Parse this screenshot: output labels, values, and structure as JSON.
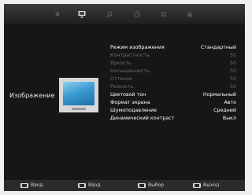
{
  "tabs": [
    {
      "icon": "tv-screen-icon",
      "active": false
    },
    {
      "icon": "display-icon",
      "active": true
    },
    {
      "icon": "music-note-icon",
      "active": false
    },
    {
      "icon": "clock-icon",
      "active": false
    },
    {
      "icon": "grid-icon",
      "active": false
    },
    {
      "icon": "lock-icon",
      "active": false
    }
  ],
  "category": "Изображение",
  "menu": [
    {
      "label": "Режим изображения",
      "value": "Стандартный",
      "enabled": true
    },
    {
      "label": "Контрастность",
      "value": "50",
      "enabled": false
    },
    {
      "label": "Яркость",
      "value": "50",
      "enabled": false
    },
    {
      "label": "Насыщенность",
      "value": "50",
      "enabled": false
    },
    {
      "label": "Оттенок",
      "value": "50",
      "enabled": false
    },
    {
      "label": "Резкость",
      "value": "50",
      "enabled": false
    },
    {
      "label": "Цветовой тон",
      "value": "Нормальный",
      "enabled": true
    },
    {
      "label": "Формат экрана",
      "value": "Авто",
      "enabled": true
    },
    {
      "label": "Шумоподавление",
      "value": "Средний",
      "enabled": true
    },
    {
      "label": "Динамический контраст",
      "value": "Выкл",
      "enabled": true
    }
  ],
  "hints": [
    {
      "label": "Ввод",
      "icon": "key-icon"
    },
    {
      "label": "Ввод",
      "icon": "key-icon"
    },
    {
      "label": "Выбор",
      "icon": "key-icon"
    },
    {
      "label": "Выход",
      "icon": "key-icon"
    }
  ],
  "colors": {
    "screen_bg": "#161616",
    "text_active": "#ffffff",
    "text_disabled": "#6c6c6c",
    "tab_active": "#e0e0e0",
    "tab_inactive": "#555555"
  }
}
